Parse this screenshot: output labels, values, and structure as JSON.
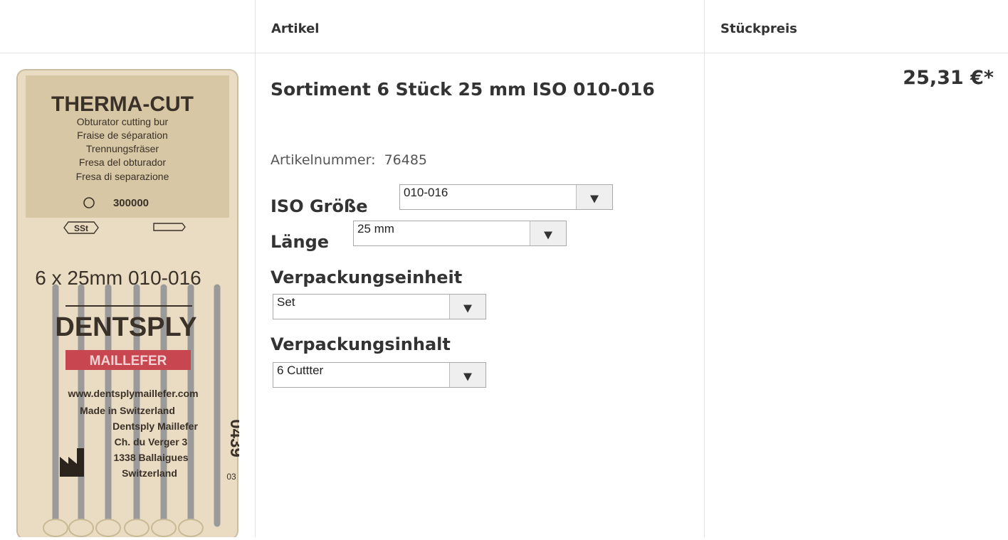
{
  "header": {
    "col_article": "Artikel",
    "col_unit_price": "Stückpreis"
  },
  "product": {
    "title": "Sortiment 6 Stück 25 mm ISO 010-016",
    "article_number_label": "Artikelnummer:",
    "article_number": "76485",
    "price": "25,31 €*",
    "image": {
      "brand": "THERMA-CUT",
      "lines": [
        "Obturator cutting bur",
        "Fraise de séparation",
        "Trennungsfräser",
        "Fresa del obturador",
        "Fresa di separazione"
      ],
      "rpm": "300000",
      "material": "SSt",
      "spec": "6 x  25mm  010-016",
      "maker": "DENTSPLY",
      "maker_sub": "MAILLEFER",
      "web": "www.dentsplymaillefer.com",
      "made_in": "Made in Switzerland",
      "address": [
        "Dentsply Maillefer",
        "Ch. du Verger 3",
        "1338 Ballaigues",
        "Switzerland"
      ],
      "side_code": "0439",
      "side_code2": "03"
    }
  },
  "options": {
    "iso_size": {
      "label": "ISO Größe",
      "value": "010-016"
    },
    "length": {
      "label": "Länge",
      "value": "25 mm"
    },
    "packaging_unit": {
      "label": "Verpackungseinheit",
      "value": "Set"
    },
    "packaging_content": {
      "label": "Verpackungsinhalt",
      "value": "6 Cuttter"
    }
  },
  "colors": {
    "border": "#e3e3e3",
    "text": "#333333",
    "package": "#e9dcc2",
    "red_band": "#c8464f"
  },
  "icons": [
    "dropdown-arrow-icon",
    "factory-icon"
  ]
}
